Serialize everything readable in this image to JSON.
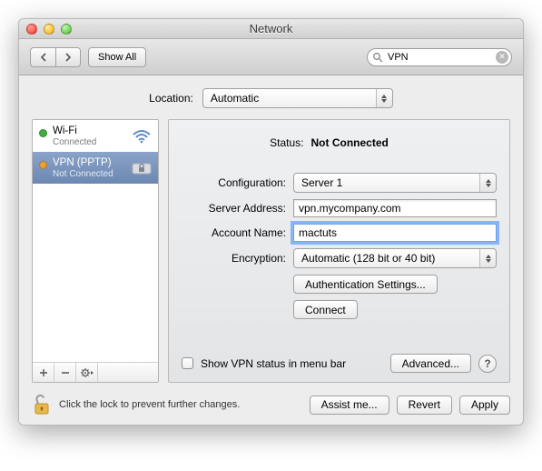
{
  "window": {
    "title": "Network"
  },
  "toolbar": {
    "show_all": "Show All"
  },
  "search": {
    "query": "VPN"
  },
  "location": {
    "label": "Location:",
    "value": "Automatic"
  },
  "sidebar": {
    "services": [
      {
        "name": "Wi-Fi",
        "sub": "Connected",
        "dot_color": "#3fae3f",
        "selected": false,
        "icon": "wifi"
      },
      {
        "name": "VPN (PPTP)",
        "sub": "Not Connected",
        "dot_color": "#e8a13a",
        "selected": true,
        "icon": "lock"
      }
    ]
  },
  "detail": {
    "status_label": "Status:",
    "status_value": "Not Connected",
    "config_label": "Configuration:",
    "config_value": "Server 1",
    "server_label": "Server Address:",
    "server_value": "vpn.mycompany.com",
    "account_label": "Account Name:",
    "account_value": "mactuts",
    "encryption_label": "Encryption:",
    "encryption_value": "Automatic (128 bit or 40 bit)",
    "auth_button": "Authentication Settings...",
    "connect_button": "Connect",
    "show_status_label": "Show VPN status in menu bar",
    "advanced_button": "Advanced..."
  },
  "footer": {
    "lock_text": "Click the lock to prevent further changes.",
    "assist": "Assist me...",
    "revert": "Revert",
    "apply": "Apply"
  }
}
